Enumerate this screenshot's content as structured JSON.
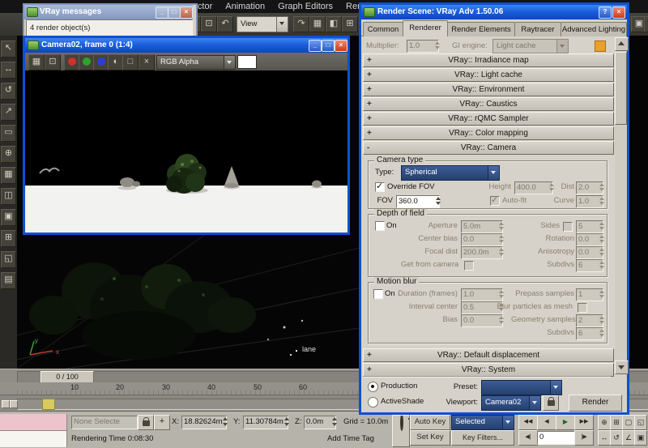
{
  "icons": {
    "window_minimize": "_",
    "window_maximize": "□",
    "window_close": "×",
    "window_help": "?",
    "rollout_plus": "+",
    "rollout_minus": "-",
    "left_toolbar": [
      "↖",
      "↔",
      "↺",
      "↗",
      "▭",
      "⊕",
      "▦",
      "◫",
      "▣",
      "⊞",
      "◱",
      "▤"
    ],
    "top_toolbar_a": [
      "↖",
      "⊡",
      "↶"
    ],
    "top_toolbar_b": [
      "↷",
      "▦",
      "◧",
      "⊞"
    ],
    "top_right": [
      "▣",
      "◉"
    ],
    "camera_toolbar": [
      "▦",
      "⊡"
    ],
    "alpha_channel": "◐",
    "mono_channel": "□",
    "clear": "×",
    "transform_typein": "+",
    "nav": [
      "⊕",
      "⊞",
      "▢",
      "◱",
      "↔",
      "↺",
      "∠",
      "▣"
    ],
    "playback": [
      "◀◀",
      "◀",
      "▶",
      "▶▶"
    ],
    "prev_key": "◀|",
    "next_key": "|▶"
  },
  "menu": {
    "items": [
      "reactor",
      "Animation",
      "Graph Editors",
      "Rendering"
    ]
  },
  "top_toolbar": {
    "view": "View"
  },
  "vray_messages": {
    "title": "VRay messages",
    "line1": "4 render object(s)"
  },
  "camera_window": {
    "title": "Camera02, frame 0 (1:4)",
    "channel": "RGB Alpha"
  },
  "viewport": {
    "object_label": "lane",
    "axis_x": "x",
    "axis_y": "y"
  },
  "timeline": {
    "slider": "0 / 100",
    "ticks": [
      "10",
      "20",
      "30",
      "40",
      "50",
      "60"
    ]
  },
  "status": {
    "selection": "None Selecte",
    "x_label": "X:",
    "x_value": "18.82624m",
    "y_label": "Y:",
    "y_value": "11.30784m",
    "z_label": "Z:",
    "z_value": "0.0m",
    "grid": "Grid = 10.0m",
    "time": "Rendering Time 0:08:30",
    "add_time_tag": "Add Time Tag"
  },
  "anim": {
    "auto_key": "Auto Key",
    "set_key": "Set Key",
    "filter": "Selected",
    "key_filters": "Key Filters...",
    "frame": "0"
  },
  "dialog": {
    "title": "Render Scene: VRay Adv 1.50.06",
    "tabs": [
      "Common",
      "Renderer",
      "Render Elements",
      "Raytracer",
      "Advanced Lighting"
    ],
    "scroll_top": {
      "multiplier_label": "Multiplier:",
      "multiplier": "1.0",
      "gi_label": "GI engine:",
      "gi_value": "Light cache"
    },
    "rollouts_top": [
      "VRay:: Irradiance map",
      "VRay:: Light cache",
      "VRay:: Environment",
      "VRay:: Caustics",
      "VRay:: rQMC Sampler",
      "VRay:: Color mapping"
    ],
    "camera": {
      "title": "VRay:: Camera",
      "type_group": "Camera type",
      "type_label": "Type:",
      "type_value": "Spherical",
      "override_fov": "Override FOV",
      "fov_label": "FOV",
      "fov": "360.0",
      "height_label": "Height",
      "height": "400.0",
      "autofit": "Auto-fit",
      "dist_label": "Dist",
      "dist": "2.0",
      "curve_label": "Curve",
      "curve": "1.0",
      "dof_group": "Depth of field",
      "dof_on": "On",
      "aperture_label": "Aperture",
      "aperture": "5.0m",
      "center_bias_label": "Center bias",
      "center_bias": "0.0",
      "focal_dist_label": "Focal dist",
      "focal_dist": "200.0m",
      "get_from_camera": "Get from camera",
      "sides_label": "Sides",
      "sides": "5",
      "rotation_label": "Rotation",
      "rotation": "0.0",
      "anisotropy_label": "Anisotropy",
      "anisotropy": "0.0",
      "dof_subdivs_label": "Subdivs",
      "dof_subdivs": "6",
      "mb_group": "Motion blur",
      "mb_on": "On",
      "duration_label": "Duration (frames)",
      "duration": "1.0",
      "interval_label": "Interval center",
      "interval": "0.5",
      "bias_label": "Bias",
      "bias": "0.0",
      "prepass_label": "Prepass samples",
      "prepass": "1",
      "blur_particles": "Blur particles as mesh",
      "geometry_label": "Geometry samples",
      "geometry": "2",
      "mb_subdivs_label": "Subdivs",
      "mb_subdivs": "6"
    },
    "rollouts_bottom": [
      "VRay:: Default displacement",
      "VRay:: System"
    ],
    "footer": {
      "production": "Production",
      "activeshade": "ActiveShade",
      "preset_label": "Preset:",
      "preset_value": "",
      "viewport_label": "Viewport:",
      "viewport_value": "Camera02",
      "render": "Render"
    }
  }
}
